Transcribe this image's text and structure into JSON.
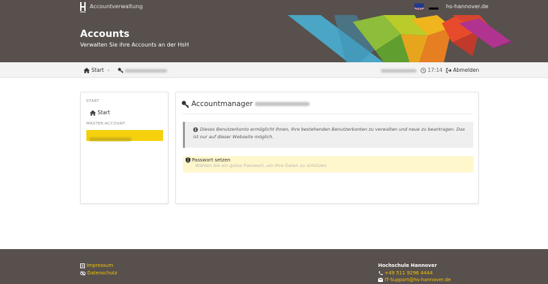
{
  "topbar": {
    "app_name": "Accountverwaltung",
    "languages": [
      {
        "code": "en",
        "label": "English"
      },
      {
        "code": "de",
        "label": "Deutsch"
      }
    ],
    "domain_link": "hs-hannover.de"
  },
  "hero": {
    "title": "Accounts",
    "subtitle": "Verwalten Sie ihre Accounts an der HsH"
  },
  "breadcrumb": {
    "home_label": "Start",
    "clock_time": "17:14",
    "logout_label": "Abmelden"
  },
  "sidebar": {
    "section_start": "START",
    "start_label": "Start",
    "section_master": "MASTER-ACCOUNT"
  },
  "main": {
    "title": "Accountmanager",
    "info_text": "Dieses Benutzerkonto ermöglicht Ihnen, Ihre bestehenden Benutzerkonten zu verwalten und neue zu beantragen. Das ist nur auf dieser Webseite möglich.",
    "password_title": "Passwort setzen",
    "password_hint": "Wählen Sie ein gutes Passwort, um Ihre Daten zu schützen"
  },
  "footer": {
    "impressum": "Impressum",
    "datenschutz": "Datenschutz",
    "org_name": "Hochschule Hannover",
    "phone": "+49 511 9296 4444",
    "email": "IT-Support@hs-hannover.de"
  },
  "colors": {
    "header_bg": "#57504d",
    "accent_yellow": "#f5d10d",
    "footer_link": "#f5c500",
    "warning_bg": "#fff7cc"
  }
}
